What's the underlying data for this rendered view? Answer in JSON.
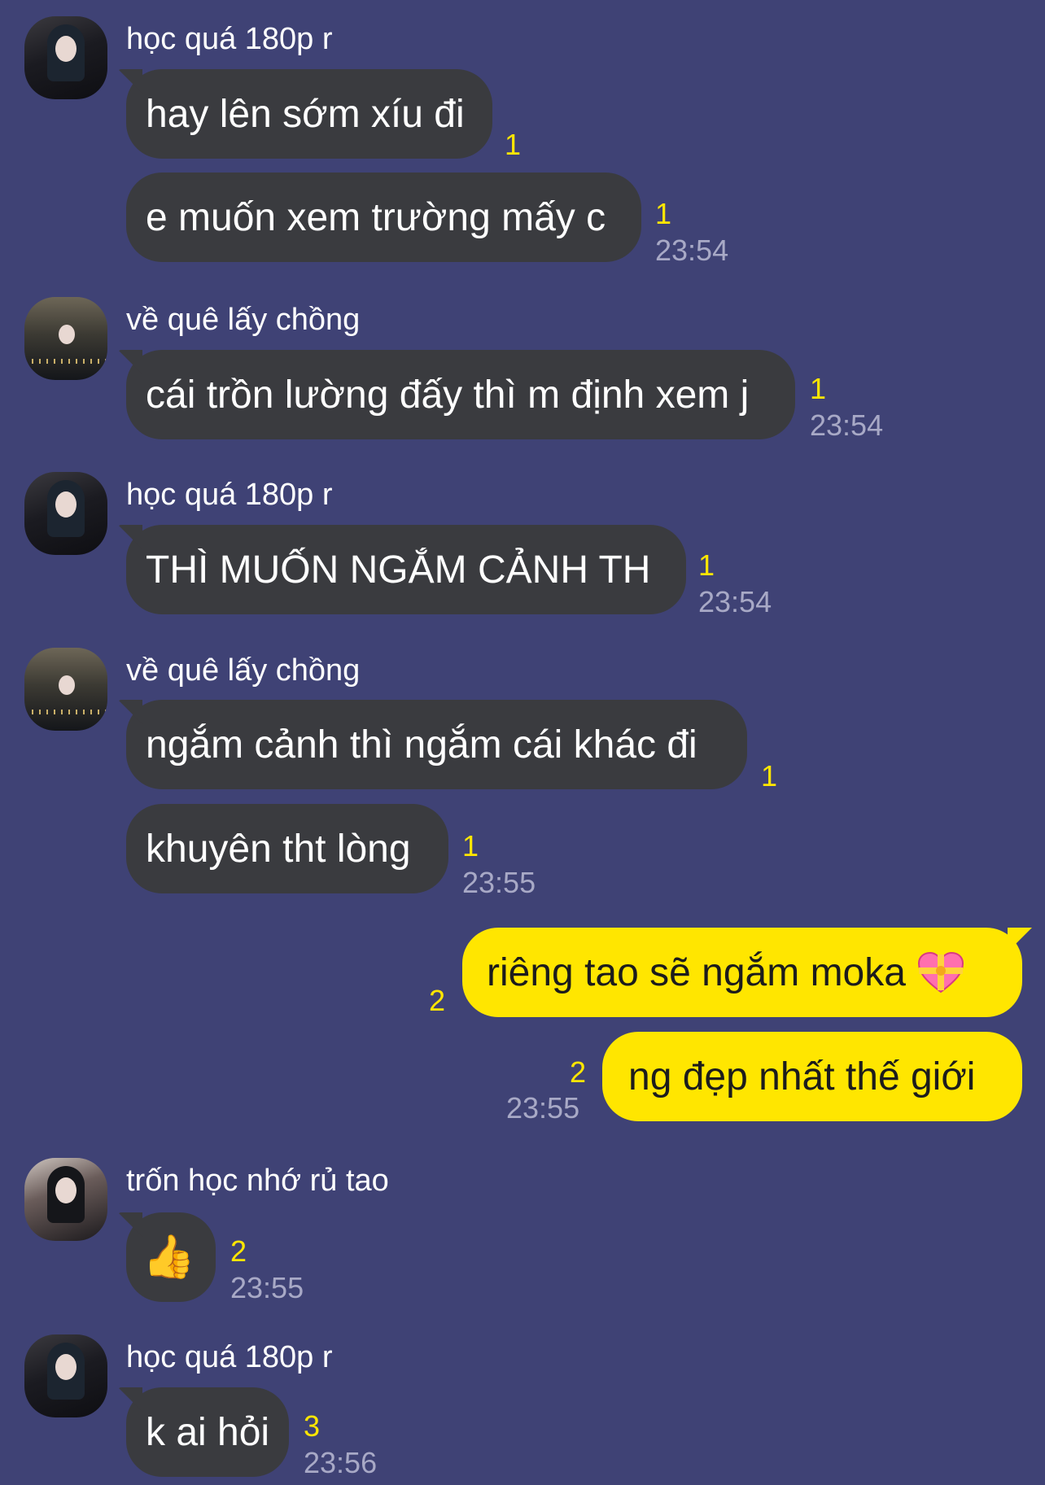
{
  "colors": {
    "background": "#3f4275",
    "incoming_bubble": "#3a3b3f",
    "outgoing_bubble": "#ffe600",
    "unread": "#ffe600",
    "time": "#a8a9c6"
  },
  "messages": [
    {
      "sender": "học quá 180p r",
      "text": "hay lên sớm xíu đi",
      "unread": "1"
    },
    {
      "text": "e muốn xem trường mấy c",
      "unread": "1",
      "time": "23:54"
    },
    {
      "sender": "về quê lấy chồng",
      "text": "cái trồn lường đấy thì m định xem j",
      "unread": "1",
      "time": "23:54"
    },
    {
      "sender": "học quá 180p r",
      "text": "THÌ MUỐN NGẮM CẢNH TH",
      "unread": "1",
      "time": "23:54"
    },
    {
      "sender": "về quê lấy chồng",
      "text": "ngắm cảnh thì ngắm cái khác đi",
      "unread": "1"
    },
    {
      "text": "khuyên tht lòng",
      "unread": "1",
      "time": "23:55"
    },
    {
      "text": "riêng tao sẽ ngắm moka",
      "emoji": "heart-with-ribbon",
      "unread": "2",
      "outgoing": true
    },
    {
      "text": "ng đẹp nhất thế giới",
      "unread": "2",
      "time": "23:55",
      "outgoing": true
    },
    {
      "sender": "trốn học nhớ rủ tao",
      "text": "👍",
      "unread": "2",
      "time": "23:55"
    },
    {
      "sender": "học quá 180p r",
      "text": "k ai hỏi",
      "unread": "3",
      "time": "23:56"
    }
  ]
}
